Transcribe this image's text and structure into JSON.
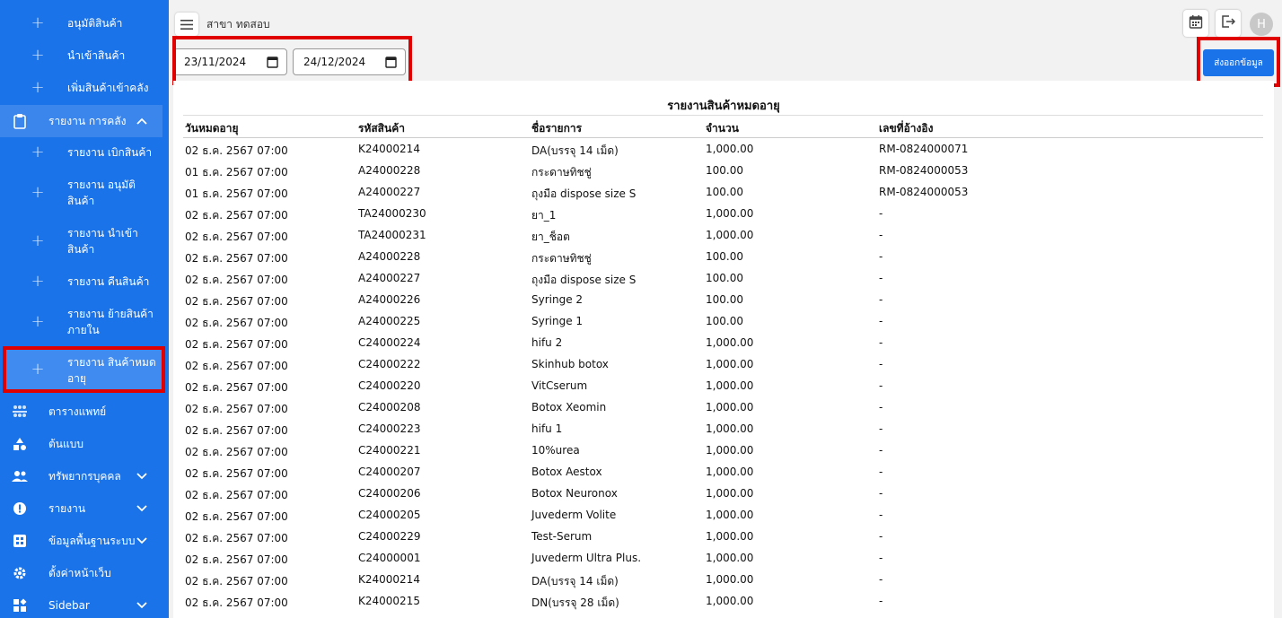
{
  "sidebar": {
    "items": [
      {
        "label": "อนุมัติสินค้า",
        "type": "sub"
      },
      {
        "label": "นำเข้าสินค้า",
        "type": "sub"
      },
      {
        "label": "เพิ่มสินค้าเข้าคลัง",
        "type": "sub"
      },
      {
        "label": "รายงาน การคลัง",
        "type": "group",
        "icon": "clipboard-icon",
        "expanded": true
      },
      {
        "label": "รายงาน เบิกสินค้า",
        "type": "sub"
      },
      {
        "label": "รายงาน อนุมัติ สินค้า",
        "type": "sub"
      },
      {
        "label": "รายงาน นำเข้า สินค้า",
        "type": "sub"
      },
      {
        "label": "รายงาน คืนสินค้า",
        "type": "sub"
      },
      {
        "label": "รายงาน ย้ายสินค้า ภายใน",
        "type": "sub"
      },
      {
        "label": "รายงาน สินค้าหมด อายุ",
        "type": "sub",
        "selected": true
      },
      {
        "label": "ตารางแพทย์",
        "type": "top",
        "icon": "people-schedule-icon"
      },
      {
        "label": "ต้นแบบ",
        "type": "top",
        "icon": "shapes-icon"
      },
      {
        "label": "ทรัพยากรบุคคล",
        "type": "top",
        "icon": "group-icon",
        "expandable": true
      },
      {
        "label": "รายงาน",
        "type": "top",
        "icon": "alert-circle-icon",
        "expandable": true
      },
      {
        "label": "ข้อมูลพื้นฐานระบบ",
        "type": "top",
        "icon": "grid-icon",
        "expandable": true
      },
      {
        "label": "ตั้งค่าหน้าเว็บ",
        "type": "top",
        "icon": "gear-icon"
      },
      {
        "label": "Sidebar",
        "type": "top",
        "icon": "widgets-icon",
        "expandable": true
      }
    ]
  },
  "header": {
    "branch": "สาขา ทดสอบ",
    "avatar_initial": "H"
  },
  "filters": {
    "start_date": "23/11/2024",
    "end_date": "24/12/2024"
  },
  "actions": {
    "export_label": "ส่งออกข้อมูล"
  },
  "report": {
    "title": "รายงานสินค้าหมดอายุ",
    "columns": [
      "วันหมดอายุ",
      "รหัสสินค้า",
      "ชื่อรายการ",
      "จำนวน",
      "เลขที่อ้างอิง"
    ],
    "rows": [
      [
        "02 ธ.ค. 2567 07:00",
        "K24000214",
        "DA(บรรจุ 14 เม็ด)",
        "1,000.00",
        "RM-0824000071"
      ],
      [
        "01 ธ.ค. 2567 07:00",
        "A24000228",
        "กระดาษทิชชู่",
        "100.00",
        "RM-0824000053"
      ],
      [
        "01 ธ.ค. 2567 07:00",
        "A24000227",
        "ถุงมือ dispose size S",
        "100.00",
        "RM-0824000053"
      ],
      [
        "02 ธ.ค. 2567 07:00",
        "TA24000230",
        "ยา_1",
        "1,000.00",
        "-"
      ],
      [
        "02 ธ.ค. 2567 07:00",
        "TA24000231",
        "ยา_ช็อต",
        "1,000.00",
        "-"
      ],
      [
        "02 ธ.ค. 2567 07:00",
        "A24000228",
        "กระดาษทิชชู่",
        "100.00",
        "-"
      ],
      [
        "02 ธ.ค. 2567 07:00",
        "A24000227",
        "ถุงมือ dispose size S",
        "100.00",
        "-"
      ],
      [
        "02 ธ.ค. 2567 07:00",
        "A24000226",
        "Syringe 2",
        "100.00",
        "-"
      ],
      [
        "02 ธ.ค. 2567 07:00",
        "A24000225",
        "Syringe 1",
        "100.00",
        "-"
      ],
      [
        "02 ธ.ค. 2567 07:00",
        "C24000224",
        "hifu 2",
        "1,000.00",
        "-"
      ],
      [
        "02 ธ.ค. 2567 07:00",
        "C24000222",
        "Skinhub botox",
        "1,000.00",
        "-"
      ],
      [
        "02 ธ.ค. 2567 07:00",
        "C24000220",
        "VitCserum",
        "1,000.00",
        "-"
      ],
      [
        "02 ธ.ค. 2567 07:00",
        "C24000208",
        "Botox Xeomin",
        "1,000.00",
        "-"
      ],
      [
        "02 ธ.ค. 2567 07:00",
        "C24000223",
        "hifu 1",
        "1,000.00",
        "-"
      ],
      [
        "02 ธ.ค. 2567 07:00",
        "C24000221",
        "10%urea",
        "1,000.00",
        "-"
      ],
      [
        "02 ธ.ค. 2567 07:00",
        "C24000207",
        "Botox Aestox",
        "1,000.00",
        "-"
      ],
      [
        "02 ธ.ค. 2567 07:00",
        "C24000206",
        "Botox Neuronox",
        "1,000.00",
        "-"
      ],
      [
        "02 ธ.ค. 2567 07:00",
        "C24000205",
        "Juvederm Volite",
        "1,000.00",
        "-"
      ],
      [
        "02 ธ.ค. 2567 07:00",
        "C24000229",
        "Test-Serum",
        "1,000.00",
        "-"
      ],
      [
        "02 ธ.ค. 2567 07:00",
        "C24000001",
        "Juvederm Ultra Plus.",
        "1,000.00",
        "-"
      ],
      [
        "02 ธ.ค. 2567 07:00",
        "K24000214",
        "DA(บรรจุ 14 เม็ด)",
        "1,000.00",
        "-"
      ],
      [
        "02 ธ.ค. 2567 07:00",
        "K24000215",
        "DN(บรรจุ 28 เม็ด)",
        "1,000.00",
        "-"
      ]
    ]
  },
  "colors": {
    "sidebar_bg": "#1a73e8",
    "highlight": "#e00000",
    "button": "#1a73e8"
  }
}
